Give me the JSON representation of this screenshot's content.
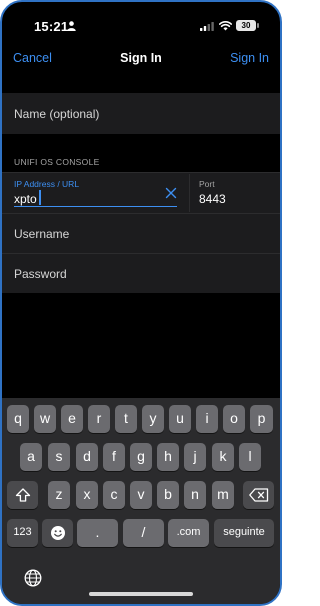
{
  "status_bar": {
    "time": "15:21",
    "battery": "30"
  },
  "nav": {
    "cancel": "Cancel",
    "title": "Sign In",
    "action": "Sign In"
  },
  "form": {
    "name_placeholder": "Name (optional)",
    "section_header": "UNIFI OS CONSOLE",
    "ip_label": "IP Address / URL",
    "ip_value": "xpto",
    "port_label": "Port",
    "port_value": "8443",
    "username_placeholder": "Username",
    "password_placeholder": "Password"
  },
  "keyboard": {
    "row1": [
      "q",
      "w",
      "e",
      "r",
      "t",
      "y",
      "u",
      "i",
      "o",
      "p"
    ],
    "row2": [
      "a",
      "s",
      "d",
      "f",
      "g",
      "h",
      "j",
      "k",
      "l"
    ],
    "row3": [
      "z",
      "x",
      "c",
      "v",
      "b",
      "n",
      "m"
    ],
    "numbers_key": "123",
    "dot_key": ".",
    "slash_key": "/",
    "dotcom_key": ".com",
    "return_key": "seguinte"
  },
  "colors": {
    "accent": "#3d8ff2",
    "background": "#000000",
    "row": "#1c1c1e",
    "key": "#6b6b6f",
    "key_dark": "#4a4a4d"
  },
  "icons": [
    "person-icon",
    "signal-icon",
    "wifi-icon",
    "battery-icon",
    "clear-icon",
    "shift-icon",
    "delete-icon",
    "emoji-icon",
    "globe-icon"
  ]
}
